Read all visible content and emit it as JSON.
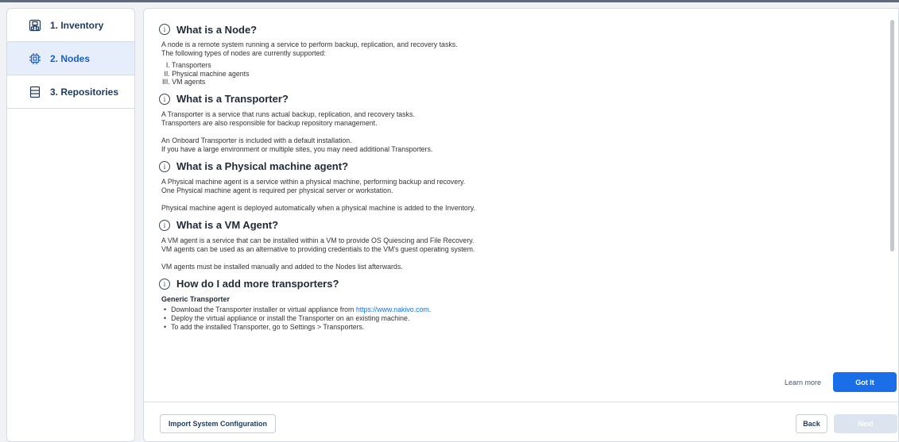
{
  "sidebar": {
    "items": [
      {
        "label": "1. Inventory",
        "icon": "inventory-icon",
        "active": false
      },
      {
        "label": "2. Nodes",
        "icon": "chip-icon",
        "active": true
      },
      {
        "label": "3. Repositories",
        "icon": "repository-icon",
        "active": false
      }
    ]
  },
  "sections": {
    "node": {
      "title": "What is a Node?",
      "p1": "A node is a remote system running a service to perform backup, replication, and recovery tasks.",
      "p2": "The following types of nodes are currently supported:",
      "list": [
        "  I. Transporters",
        " II. Physical machine agents",
        "III. VM agents"
      ]
    },
    "transporter": {
      "title": "What is a Transporter?",
      "p1": "A Transporter is a service that runs actual backup, replication, and recovery tasks.",
      "p2": "Transporters are also responsible for backup repository management.",
      "p3": "An Onboard Transporter is included with a default installation.",
      "p4": "If you have a large environment or multiple sites, you may need additional Transporters."
    },
    "physical": {
      "title": "What is a Physical machine agent?",
      "p1": "A Physical machine agent is a service within a physical machine, performing backup and recovery.",
      "p2": "One Physical machine agent is required per physical server or workstation.",
      "p3": "Physical machine agent is deployed automatically when a physical machine is added to the Inventory."
    },
    "vmagent": {
      "title": "What is a VM Agent?",
      "p1": "A VM agent is a service that can be installed within a VM to provide OS Quiescing and File Recovery.",
      "p2": "VM agents can be used as an alternative to providing credentials to the VM's guest operating system.",
      "p3": "VM agents must be installed manually and added to the Nodes list afterwards."
    },
    "add": {
      "title": "How do I add more transporters?",
      "subhead": "Generic Transporter",
      "b1_prefix": "Download the Transporter installer or virtual appliance from ",
      "b1_link": "https://www.nakivo.com",
      "b1_suffix": ".",
      "b2": "Deploy the virtual appliance or install the Transporter on an existing machine.",
      "b3": "To add the installed Transporter, go to Settings > Transporters."
    }
  },
  "actions": {
    "learn_more": "Learn more",
    "got_it": "Got It"
  },
  "footer": {
    "import": "Import System Configuration",
    "back": "Back",
    "next": "Next"
  },
  "colors": {
    "accent": "#1a6ee8",
    "active_bg": "#e6eefb",
    "disabled": "#dbe4ef"
  }
}
